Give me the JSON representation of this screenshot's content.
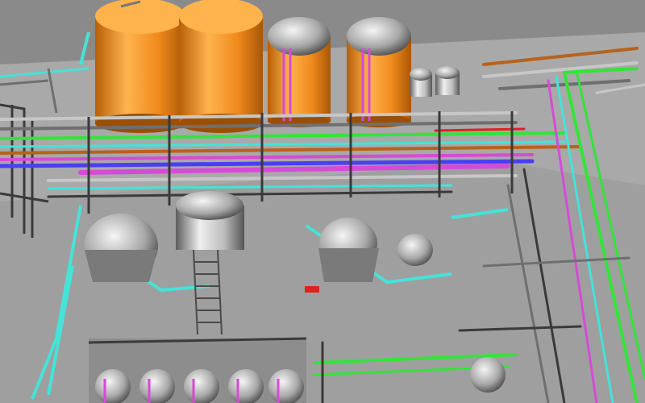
{
  "scene": {
    "subject": "3d-piping-plant-model",
    "colors": {
      "background": "#8a8a8a",
      "floor": "#a9a9a9",
      "floor_dark": "#9c9c9c",
      "steel": "#6f6f6f",
      "steel_dark": "#3a3a3a",
      "tank_orange": "#f08a1c",
      "tank_orange_light": "#ffb34d",
      "tank_orange_dark": "#b85f08",
      "vessel_silver": "#c9c9c9",
      "vessel_silver_dark": "#6a6a6a",
      "pipe_green": "#35e33a",
      "pipe_cyan": "#45e3d8",
      "pipe_magenta": "#d64bd6",
      "pipe_blue": "#4a3ff2",
      "pipe_brown": "#b8621c",
      "pipe_gray": "#c7c7c7",
      "pipe_red": "#e02020"
    }
  }
}
